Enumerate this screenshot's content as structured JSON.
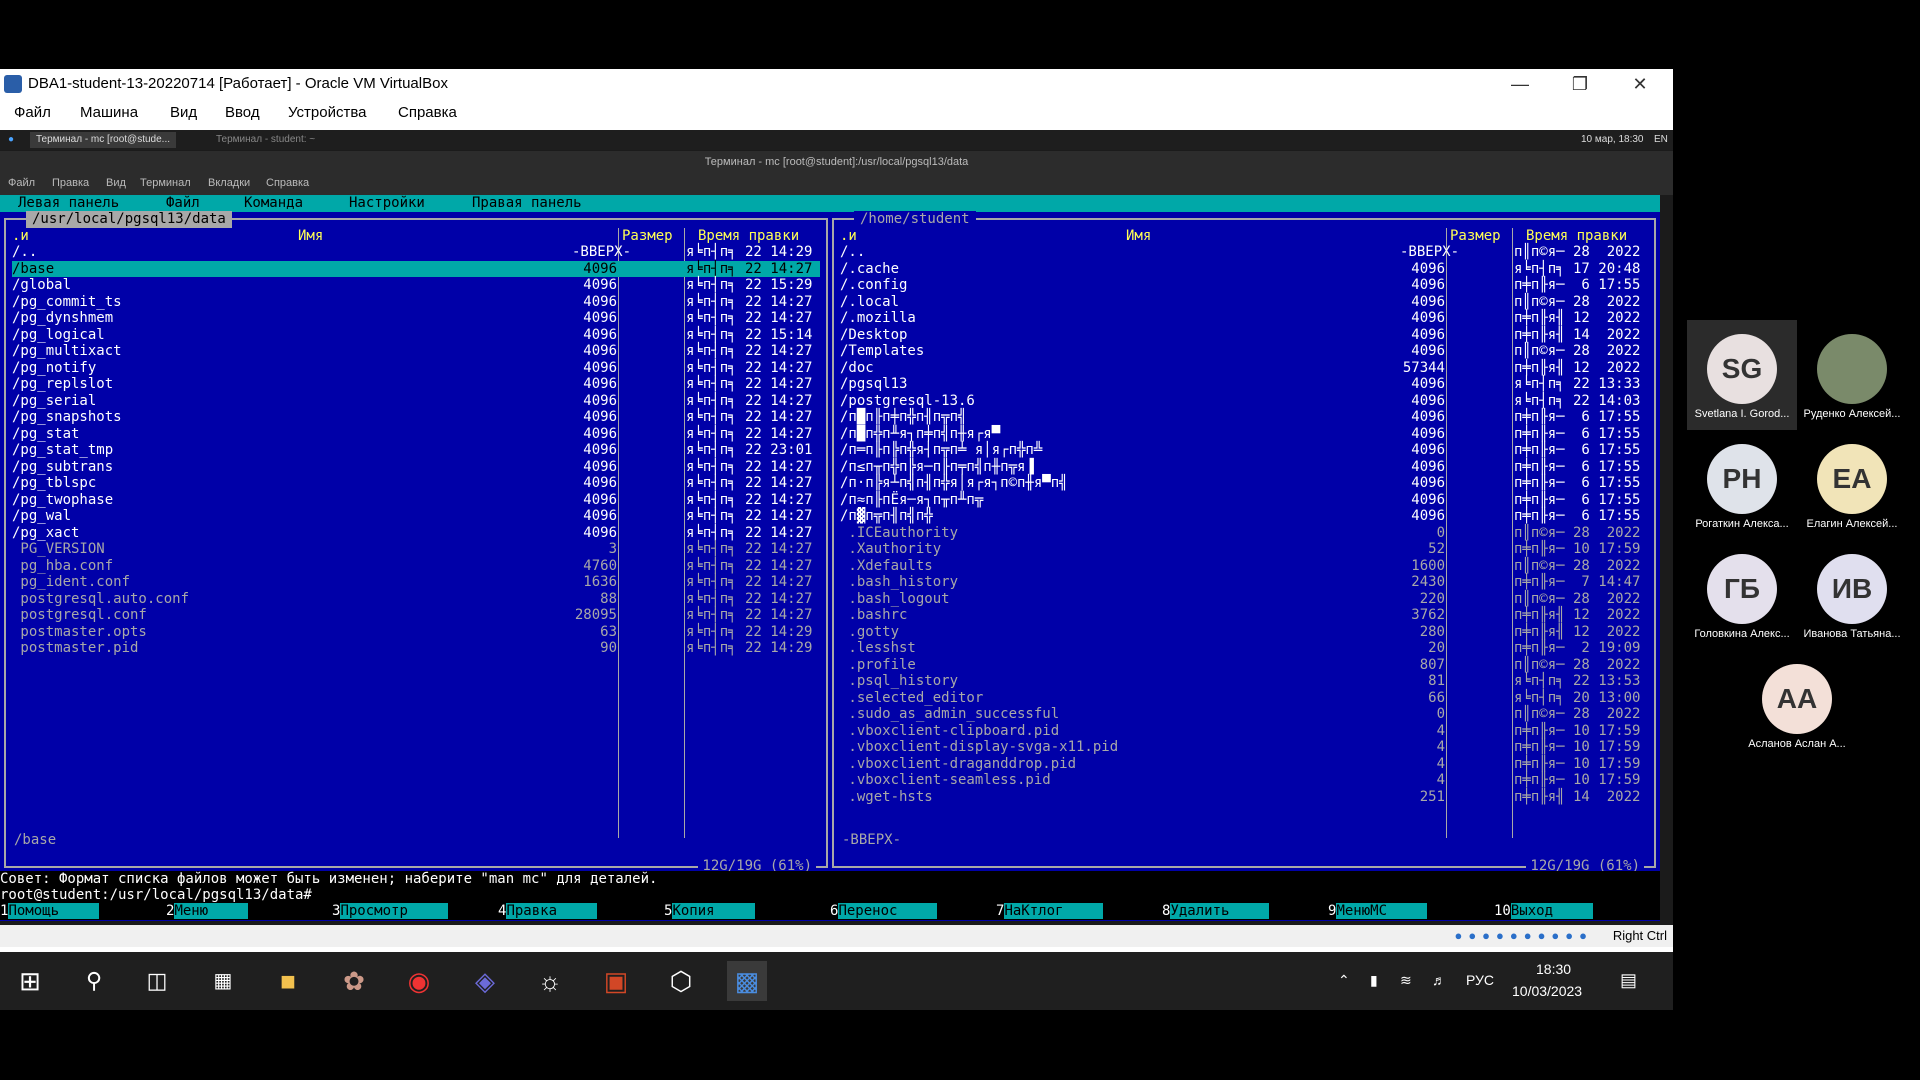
{
  "vbox": {
    "title": "DBA1-student-13-20220714 [Работает] - Oracle VM VirtualBox",
    "menu": [
      "Файл",
      "Машина",
      "Вид",
      "Ввод",
      "Устройства",
      "Справка"
    ],
    "status_right": "Right Ctrl"
  },
  "guest": {
    "tabs": [
      "Терминал - mc [root@stude...",
      "Терминал - student: ~"
    ],
    "clock": "10 мар, 18:30",
    "lang": "EN",
    "term_title": "Терминал - mc [root@student]:/usr/local/pgsql13/data",
    "term_menu": [
      "Файл",
      "Правка",
      "Вид",
      "Терминал",
      "Вкладки",
      "Справка"
    ]
  },
  "mc": {
    "top_menu": [
      "Левая панель",
      "Файл",
      "Команда",
      "Настройки",
      "Правая панель"
    ],
    "left": {
      "path": "/usr/local/pgsql13/data",
      "col_sort": ".и",
      "col_name": "Имя",
      "col_size": "Размер",
      "col_time": "Время правки",
      "rows": [
        {
          "name": "/..",
          "size": "-ВВЕРХ-",
          "time": "я╘п┤п╕ 22 14:29"
        },
        {
          "name": "/base",
          "size": "4096",
          "time": "я╘п┤п╕ 22 14:27"
        },
        {
          "name": "/global",
          "size": "4096",
          "time": "я╘п┤п╕ 22 15:29"
        },
        {
          "name": "/pg_commit_ts",
          "size": "4096",
          "time": "я╘п┤п╕ 22 14:27"
        },
        {
          "name": "/pg_dynshmem",
          "size": "4096",
          "time": "я╘п┤п╕ 22 14:27"
        },
        {
          "name": "/pg_logical",
          "size": "4096",
          "time": "я╘п┤п╕ 22 15:14"
        },
        {
          "name": "/pg_multixact",
          "size": "4096",
          "time": "я╘п┤п╕ 22 14:27"
        },
        {
          "name": "/pg_notify",
          "size": "4096",
          "time": "я╘п┤п╕ 22 14:27"
        },
        {
          "name": "/pg_replslot",
          "size": "4096",
          "time": "я╘п┤п╕ 22 14:27"
        },
        {
          "name": "/pg_serial",
          "size": "4096",
          "time": "я╘п┤п╕ 22 14:27"
        },
        {
          "name": "/pg_snapshots",
          "size": "4096",
          "time": "я╘п┤п╕ 22 14:27"
        },
        {
          "name": "/pg_stat",
          "size": "4096",
          "time": "я╘п┤п╕ 22 14:27"
        },
        {
          "name": "/pg_stat_tmp",
          "size": "4096",
          "time": "я╘п┤п╕ 22 23:01"
        },
        {
          "name": "/pg_subtrans",
          "size": "4096",
          "time": "я╘п┤п╕ 22 14:27"
        },
        {
          "name": "/pg_tblspc",
          "size": "4096",
          "time": "я╘п┤п╕ 22 14:27"
        },
        {
          "name": "/pg_twophase",
          "size": "4096",
          "time": "я╘п┤п╕ 22 14:27"
        },
        {
          "name": "/pg_wal",
          "size": "4096",
          "time": "я╘п┤п╕ 22 14:27"
        },
        {
          "name": "/pg_xact",
          "size": "4096",
          "time": "я╘п┤п╕ 22 14:27"
        },
        {
          "name": " PG_VERSION",
          "size": "3",
          "time": "я╘п┤п╕ 22 14:27"
        },
        {
          "name": " pg_hba.conf",
          "size": "4760",
          "time": "я╘п┤п╕ 22 14:27"
        },
        {
          "name": " pg_ident.conf",
          "size": "1636",
          "time": "я╘п┤п╕ 22 14:27"
        },
        {
          "name": " postgresql.auto.conf",
          "size": "88",
          "time": "я╘п┤п╕ 22 14:27"
        },
        {
          "name": " postgresql.conf",
          "size": "28095",
          "time": "я╘п┤п╕ 22 14:27"
        },
        {
          "name": " postmaster.opts",
          "size": "63",
          "time": "я╘п┤п╕ 22 14:29"
        },
        {
          "name": " postmaster.pid",
          "size": "90",
          "time": "я╘п┤п╕ 22 14:29"
        }
      ],
      "mini_status": "/base",
      "free": "12G/19G (61%)"
    },
    "right": {
      "path": "/home/student",
      "col_sort": ".и",
      "col_name": "Имя",
      "col_size": "Размер",
      "col_time": "Время правки",
      "rows": [
        {
          "name": "/..",
          "size": "-ВВЕРХ-",
          "time": "п║п©я─ 28  2022"
        },
        {
          "name": "/.cache",
          "size": "4096",
          "time": "я╘п┤п╕ 17 20:48"
        },
        {
          "name": "/.config",
          "size": "4096",
          "time": "п╪п╟я─  6 17:55"
        },
        {
          "name": "/.local",
          "size": "4096",
          "time": "п║п©я─ 28  2022"
        },
        {
          "name": "/.mozilla",
          "size": "4096",
          "time": "п╪п╟я╢ 12  2022"
        },
        {
          "name": "/Desktop",
          "size": "4096",
          "time": "п╪п╟я╢ 14  2022"
        },
        {
          "name": "/Templates",
          "size": "4096",
          "time": "п║п©я─ 28  2022"
        },
        {
          "name": "/doc",
          "size": "57344",
          "time": "п╪п╟я╢ 12  2022"
        },
        {
          "name": "/pgsql13",
          "size": "4096",
          "time": "я╘п┤п╕ 22 13:33"
        },
        {
          "name": "/postgresql-13.6",
          "size": "4096",
          "time": "я╘п┤п╕ 22 14:03"
        },
        {
          "name": "/п█п╟п╪п╬п╢п╦п╣",
          "size": "4096",
          "time": "п╪п╟я─  6 17:55"
        },
        {
          "name": "/п█п╬п╨я┐п╪п╣п╫я┌я▀",
          "size": "4096",
          "time": "п╪п╟я─  6 17:55"
        },
        {
          "name": "/п═п╟п╠п╬я┤п╦п╧ я│я┌п╬п╩",
          "size": "4096",
          "time": "п╪п╟я─  6 17:55"
        },
        {
          "name": "/п≤п╥п╬п╠я─п╟п╤п╣п╫п╦я▐",
          "size": "4096",
          "time": "п╪п╟я─  6 17:55"
        },
        {
          "name": "/п·п╠я┴п╣п╢п╬я│я┌я┐п©п╫я▀п╣",
          "size": "4096",
          "time": "п╪п╟я─  6 17:55"
        },
        {
          "name": "/п≈п╟пЁя─я┐п╥п╨п╦",
          "size": "4096",
          "time": "п╪п╟я─  6 17:55"
        },
        {
          "name": "/п▓п╦п╢п╣п╬",
          "size": "4096",
          "time": "п╪п╟я─  6 17:55"
        },
        {
          "name": " .ICEauthority",
          "size": "0",
          "time": "п║п©я─ 28  2022"
        },
        {
          "name": " .Xauthority",
          "size": "52",
          "time": "п╪п╟я─ 10 17:59"
        },
        {
          "name": " .Xdefaults",
          "size": "1600",
          "time": "п║п©я─ 28  2022"
        },
        {
          "name": " .bash_history",
          "size": "2430",
          "time": "п╪п╟я─  7 14:47"
        },
        {
          "name": " .bash_logout",
          "size": "220",
          "time": "п║п©я─ 28  2022"
        },
        {
          "name": " .bashrc",
          "size": "3762",
          "time": "п╪п╟я╢ 12  2022"
        },
        {
          "name": " .gotty",
          "size": "280",
          "time": "п╪п╟я╢ 12  2022"
        },
        {
          "name": " .lesshst",
          "size": "20",
          "time": "п╪п╟я─  2 19:09"
        },
        {
          "name": " .profile",
          "size": "807",
          "time": "п║п©я─ 28  2022"
        },
        {
          "name": " .psql_history",
          "size": "81",
          "time": "я╘п┤п╕ 22 13:53"
        },
        {
          "name": " .selected_editor",
          "size": "66",
          "time": "я╘п┤п╕ 20 13:00"
        },
        {
          "name": " .sudo_as_admin_successful",
          "size": "0",
          "time": "п║п©я─ 28  2022"
        },
        {
          "name": " .vboxclient-clipboard.pid",
          "size": "4",
          "time": "п╪п╟я─ 10 17:59"
        },
        {
          "name": " .vboxclient-display-svga-x11.pid",
          "size": "4",
          "time": "п╪п╟я─ 10 17:59"
        },
        {
          "name": " .vboxclient-draganddrop.pid",
          "size": "4",
          "time": "п╪п╟я─ 10 17:59"
        },
        {
          "name": " .vboxclient-seamless.pid",
          "size": "4",
          "time": "п╪п╟я─ 10 17:59"
        },
        {
          "name": " .wget-hsts",
          "size": "251",
          "time": "п╪п╟я╢ 14  2022"
        }
      ],
      "mini_status": "-ВВЕРХ-",
      "free": "12G/19G (61%)"
    },
    "hint": "Совет: Формат списка файлов может быть изменен; наберите \"man mc\" для деталей.",
    "prompt": "root@student:/usr/local/pgsql13/data#",
    "fkeys": [
      {
        "n": "1",
        "l": "Помощь"
      },
      {
        "n": "2",
        "l": "Меню"
      },
      {
        "n": "3",
        "l": "Просмотр"
      },
      {
        "n": "4",
        "l": "Правка"
      },
      {
        "n": "5",
        "l": "Копия"
      },
      {
        "n": "6",
        "l": "Перенос"
      },
      {
        "n": "7",
        "l": "НаКтлог"
      },
      {
        "n": "8",
        "l": "Удалить"
      },
      {
        "n": "9",
        "l": "МенюMC"
      },
      {
        "n": "10",
        "l": "Выход"
      }
    ]
  },
  "taskbar": {
    "lang": "РУС",
    "time": "18:30",
    "date": "10/03/2023"
  },
  "participants": [
    {
      "initials": "SG",
      "name": "Svetlana I. Gorod...",
      "color": "#e8e0e0"
    },
    {
      "initials": "",
      "name": "Руденко Алексей...",
      "color": "#7a8a6a"
    },
    {
      "initials": "РН",
      "name": "Рогаткин Алекса...",
      "color": "#dfe3ea"
    },
    {
      "initials": "ЕА",
      "name": "Елагин Алексей...",
      "color": "#f1e4b8"
    },
    {
      "initials": "ГБ",
      "name": "Головкина Алекс...",
      "color": "#e4e0ec"
    },
    {
      "initials": "ИВ",
      "name": "Иванова Татьяна...",
      "color": "#e0dfef"
    },
    {
      "initials": "АА",
      "name": "Асланов Аслан А...",
      "color": "#f3e0d8"
    }
  ]
}
